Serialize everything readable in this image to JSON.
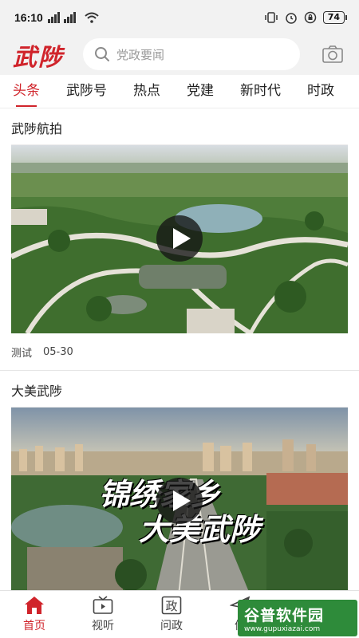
{
  "status": {
    "time": "16:10",
    "battery": "74"
  },
  "header": {
    "logo": "武陟",
    "search_placeholder": "党政要闻"
  },
  "tabs": [
    {
      "label": "头条",
      "active": true
    },
    {
      "label": "武陟号"
    },
    {
      "label": "热点"
    },
    {
      "label": "党建"
    },
    {
      "label": "新时代"
    },
    {
      "label": "时政"
    }
  ],
  "feed": [
    {
      "title": "武陟航拍",
      "source": "测试",
      "date": "05-30"
    },
    {
      "title": "大美武陟",
      "overlay_line1": "锦绣家乡",
      "overlay_line2": "大美武陟"
    }
  ],
  "bottom_nav": [
    {
      "label": "首页",
      "icon": "home-icon",
      "active": true
    },
    {
      "label": "视听",
      "icon": "tv-icon"
    },
    {
      "label": "问政",
      "icon": "politics-icon",
      "glyph": "政"
    },
    {
      "label": "便",
      "icon": "paper-plane-icon"
    }
  ],
  "watermark": {
    "text": "谷普软件园",
    "url": "www.gupuxiazai.com"
  },
  "colors": {
    "accent": "#d0242b",
    "watermark": "#2e8b3a"
  }
}
